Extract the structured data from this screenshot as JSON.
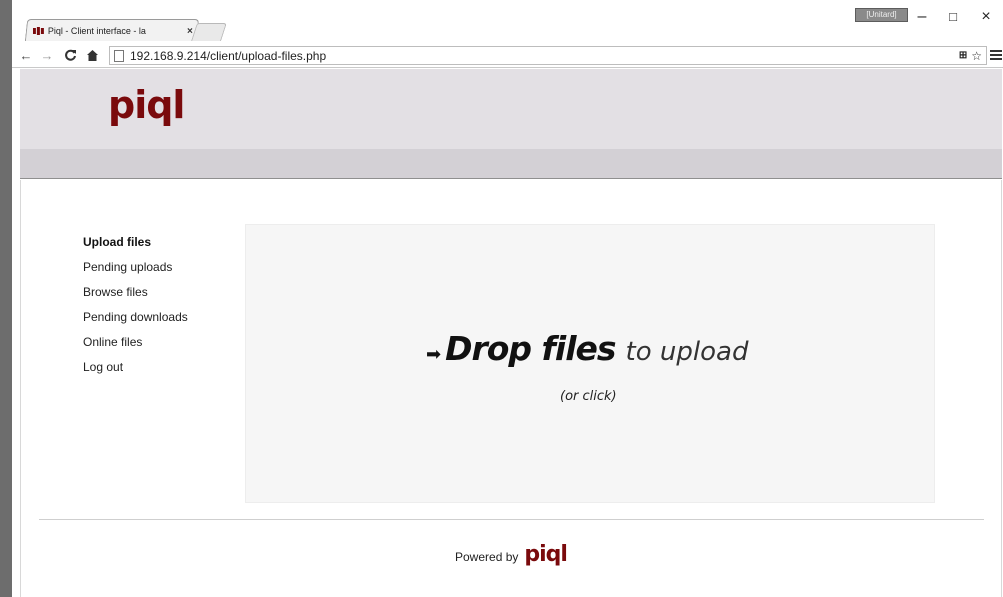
{
  "browser": {
    "tab_title": "Piql - Client interface - la",
    "tab_close": "×",
    "user_badge": "[Unitard]",
    "url": "192.168.9.214/client/upload-files.php",
    "window_controls": {
      "minimize": "–",
      "maximize": "□",
      "close": "×"
    }
  },
  "header": {
    "logo": "piql"
  },
  "sidebar": {
    "items": [
      {
        "label": "Upload files",
        "active": true
      },
      {
        "label": "Pending uploads"
      },
      {
        "label": "Browse files"
      },
      {
        "label": "Pending downloads"
      },
      {
        "label": "Online files"
      },
      {
        "label": "Log out"
      }
    ]
  },
  "dropzone": {
    "strong": "Drop files",
    "light": "to upload",
    "sub": "(or click)"
  },
  "footer": {
    "text": "Powered by",
    "logo": "piql"
  },
  "colors": {
    "brand": "#7a0a0c",
    "header_bg": "#e3e0e4",
    "header_bar": "#d3d0d5",
    "dropzone_bg": "#f6f6f6"
  }
}
